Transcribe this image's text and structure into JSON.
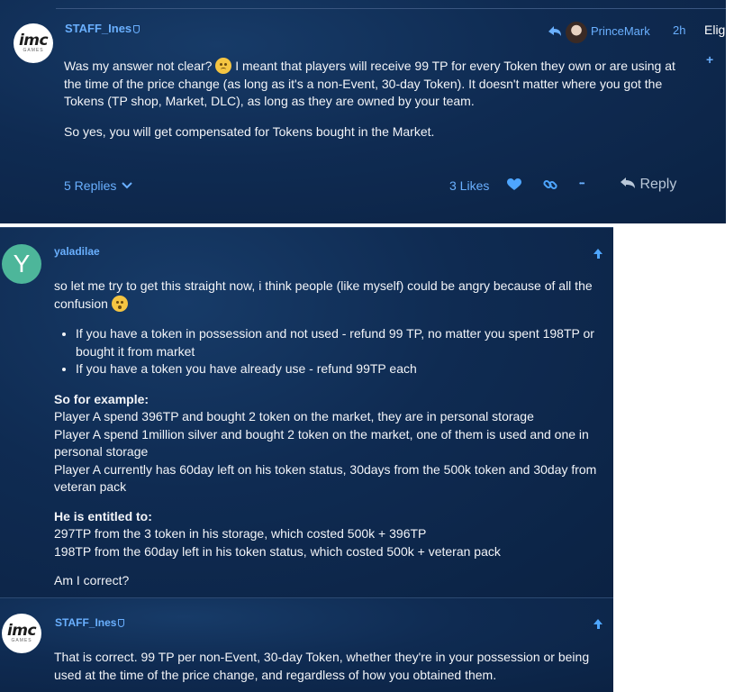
{
  "post1": {
    "username": "STAFF_Ines",
    "reply_to": "PrinceMark",
    "time": "2h",
    "sidebar_peek": "Elig",
    "sidebar_plus": "+",
    "para1_a": "Was my answer not clear?",
    "para1_b": " I meant that players will receive 99 TP for every Token they own or are using at the time of the price change (as long as it's a non-Event, 30-day Token). It doesn't matter where you got the Tokens (TP shop, Market, DLC), as long as they are owned by your team.",
    "para2": "So yes, you will get compensated for Tokens bought in the Market.",
    "replies": "5 Replies",
    "likes": "3 Likes",
    "more": "•••",
    "reply": "Reply"
  },
  "post2": {
    "avatar_letter": "Y",
    "username": "yaladilae",
    "intro_a": "so let me try to get this straight now, i think people (like myself) could be angry because of all the confusion",
    "bullets": [
      "If you have a token in possession and not used - refund 99 TP, no matter you spent 198TP or bought it from market",
      "If you have a token you have already use - refund 99TP each"
    ],
    "example_heading": "So for example:",
    "example_lines": [
      "Player A spend 396TP and bought 2 token on the market, they are in personal storage",
      "Player A spend 1million silver and bought 2 token on the market, one of them is used and one in personal storage",
      "Player A currently has 60day left on his token status, 30days from the 500k token and 30day from veteran pack"
    ],
    "entitled_heading": "He is entitled to:",
    "entitled_lines": [
      "297TP from the 3 token in his storage, which costed 500k + 396TP",
      "198TP from the 60day left in his token status, which costed 500k + veteran pack"
    ],
    "question": "Am I correct?"
  },
  "post3": {
    "username": "STAFF_Ines",
    "text": "That is correct. 99 TP per non-Event, 30-day Token, whether they're in your possession or being used at the time of the price change, and regardless of how you obtained them."
  },
  "avatar_logo": "imc",
  "avatar_sub": "GAMES",
  "colors": {
    "accent": "#6ab0ff",
    "panel": "#0f2b52",
    "text": "#f2f4f8"
  }
}
